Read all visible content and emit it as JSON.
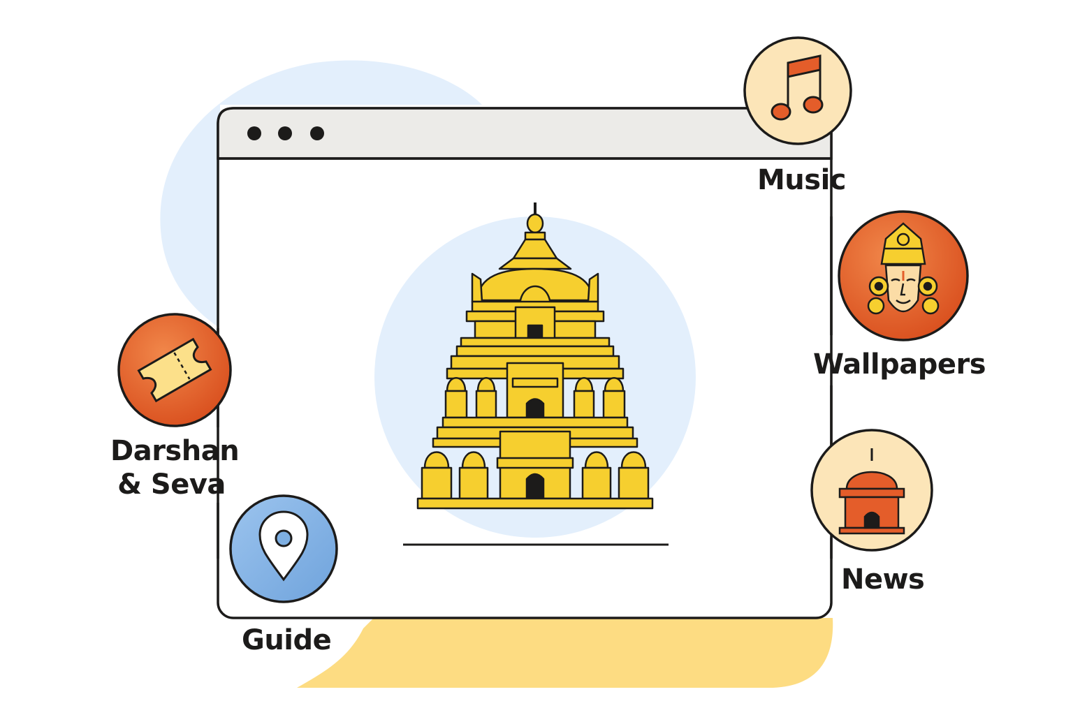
{
  "window": {
    "title_bar_dots": 3
  },
  "hero": {
    "image": "temple-gopuram"
  },
  "features": {
    "darshan": {
      "line1": "Darshan",
      "line2": "& Seva",
      "icon": "ticket-icon",
      "color": "#e45d2a"
    },
    "guide": {
      "label": "Guide",
      "icon": "location-pin-icon",
      "color": "#7eafe2"
    },
    "music": {
      "label": "Music",
      "icon": "music-note-icon",
      "color": "#fce5b8"
    },
    "wallpapers": {
      "label": "Wallpapers",
      "icon": "deity-face-icon",
      "color": "#e45d2a"
    },
    "news": {
      "label": "News",
      "icon": "temple-dome-icon",
      "color": "#fce5b8"
    }
  },
  "colors": {
    "accent_orange": "#e45d2a",
    "gold": "#f6cf2f",
    "sky": "#e3effc",
    "sand": "#fddc82",
    "outline": "#1c1b1a"
  }
}
